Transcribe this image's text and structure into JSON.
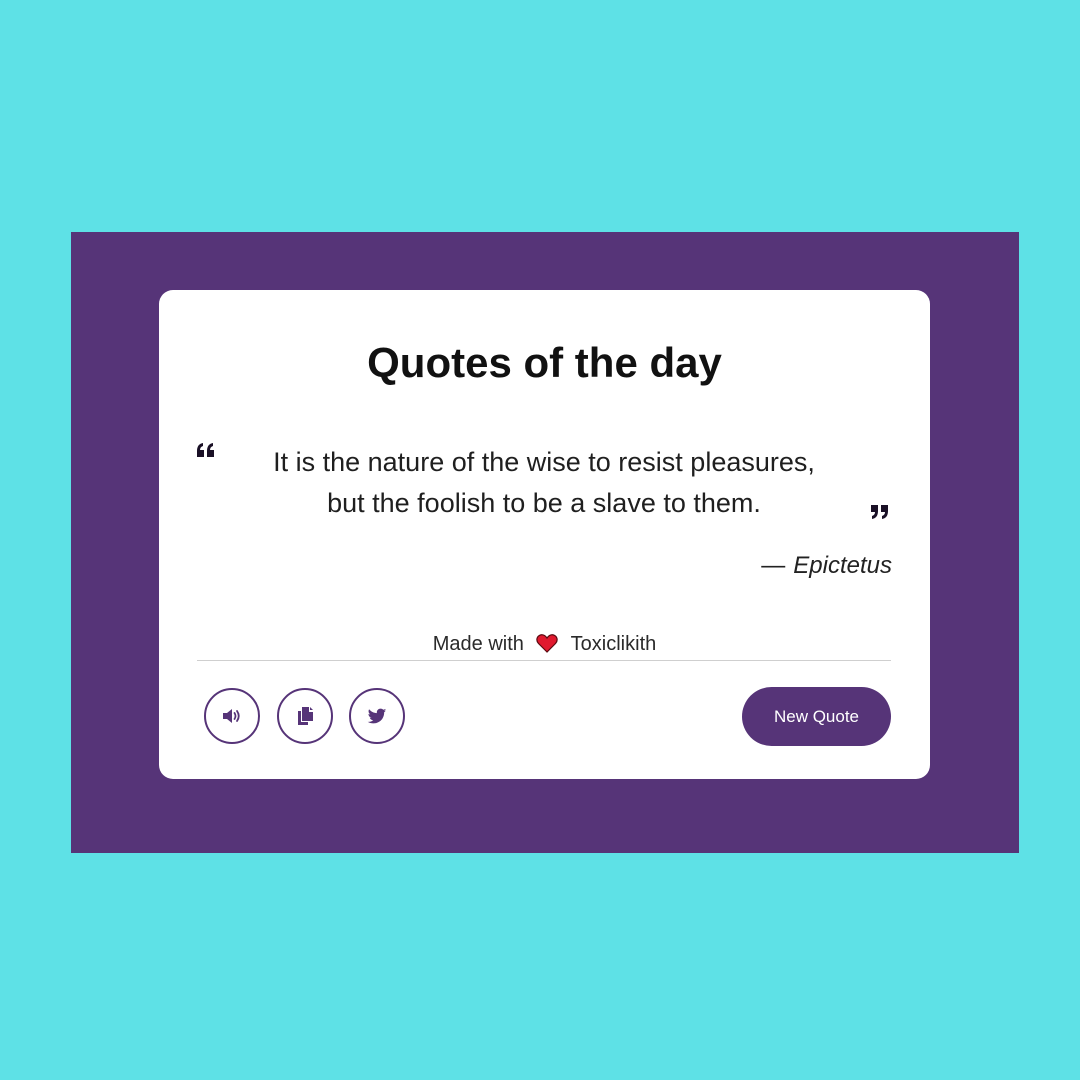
{
  "card": {
    "title": "Quotes of the day",
    "quote_line_1": "It is the nature of the wise to resist pleasures,",
    "quote_line_2": "but the foolish to be a slave to them.",
    "author_dash": "—",
    "author": "Epictetus"
  },
  "footer": {
    "made_with_label": "Made with",
    "heart_icon": "heart-icon",
    "credit_name": "Toxiclikith"
  },
  "actions": {
    "sound_icon": "volume-icon",
    "copy_icon": "copy-icon",
    "twitter_icon": "twitter-icon",
    "new_quote_label": "New Quote"
  },
  "colors": {
    "page_background": "#5ee1e6",
    "frame_background": "#563478",
    "card_background": "#ffffff",
    "accent": "#563478",
    "heart": "#e0192e"
  }
}
